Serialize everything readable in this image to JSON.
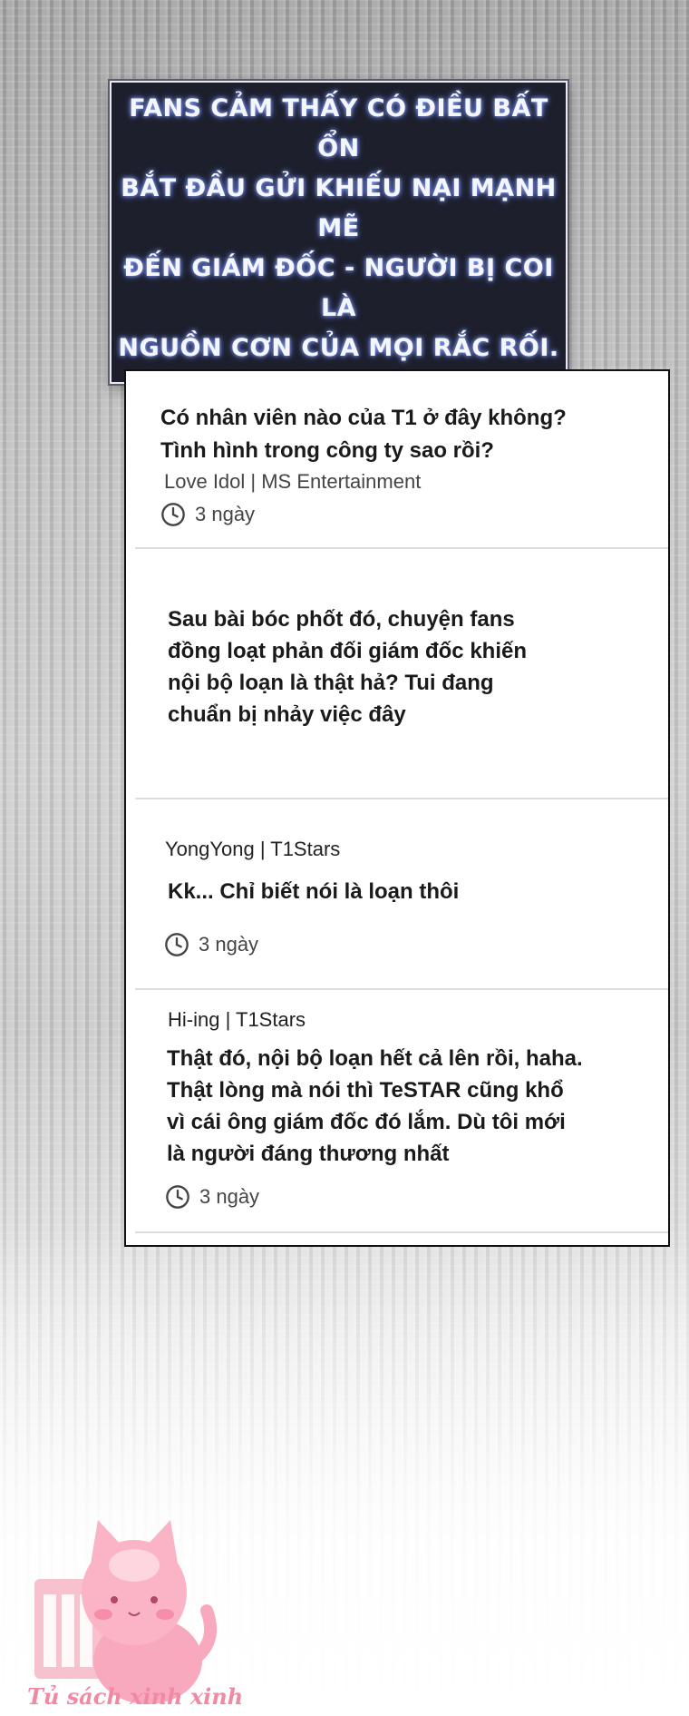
{
  "narration": {
    "lines": [
      "Fans cảm thấy có điều bất ổn",
      "bắt đầu gửi khiếu nại mạnh mẽ",
      "đến giám đốc - người bị coi là",
      "nguồn cơn của mọi rắc rối."
    ]
  },
  "posts": [
    {
      "title_lines": [
        "Có nhân viên nào của T1 ở đây không?",
        "Tình hình trong công ty sao rồi?"
      ],
      "author": "Love Idol | MS Entertainment",
      "time": "3 ngày",
      "time_icon": "clock-icon"
    },
    {
      "body_lines": [
        "Sau bài bóc phốt đó, chuyện fans",
        "đồng loạt phản đối giám đốc khiến",
        "nội bộ loạn là thật hả? Tui đang",
        "chuẩn bị nhảy việc đây"
      ]
    },
    {
      "author": "YongYong | T1Stars",
      "body_lines": [
        "Kk... Chỉ biết nói là loạn thôi"
      ],
      "time": "3 ngày",
      "time_icon": "clock-icon"
    },
    {
      "author": "Hi-ing | T1Stars",
      "body_lines": [
        "Thật đó, nội bộ loạn hết cả lên rồi, haha.",
        "Thật lòng mà nói thì TeSTAR cũng khổ",
        "vì cái ông giám đốc đó lắm. Dù tôi mới",
        "là người đáng thương nhất"
      ],
      "time": "3 ngày",
      "time_icon": "clock-icon"
    }
  ],
  "watermark": {
    "text": "Tủ sách xinh xinh",
    "icon": "cat-bookshelf-logo",
    "color": "#f08aa3"
  }
}
